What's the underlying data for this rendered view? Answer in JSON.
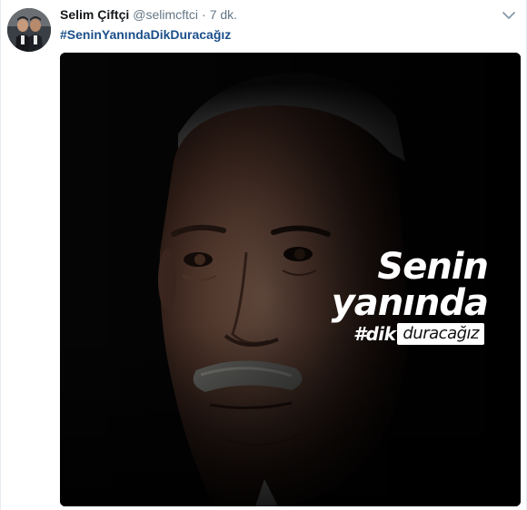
{
  "tweet": {
    "author": {
      "display_name": "Selim Çiftçi",
      "handle": "@selimcftci",
      "avatar_icon": "profile-photo"
    },
    "separator": "·",
    "timestamp": "7 dk.",
    "text": "#SeninYanındaDikDuracağız",
    "menu_icon": "chevron-down-icon",
    "media": {
      "overlay_line1": "Senin",
      "overlay_line2": "yanında",
      "overlay_hash": "#dik",
      "overlay_boxed": "duracağız"
    }
  },
  "colors": {
    "name": "#14171a",
    "secondary": "#657786",
    "hashtag": "#1b4f8a",
    "media_bg": "#050505"
  }
}
